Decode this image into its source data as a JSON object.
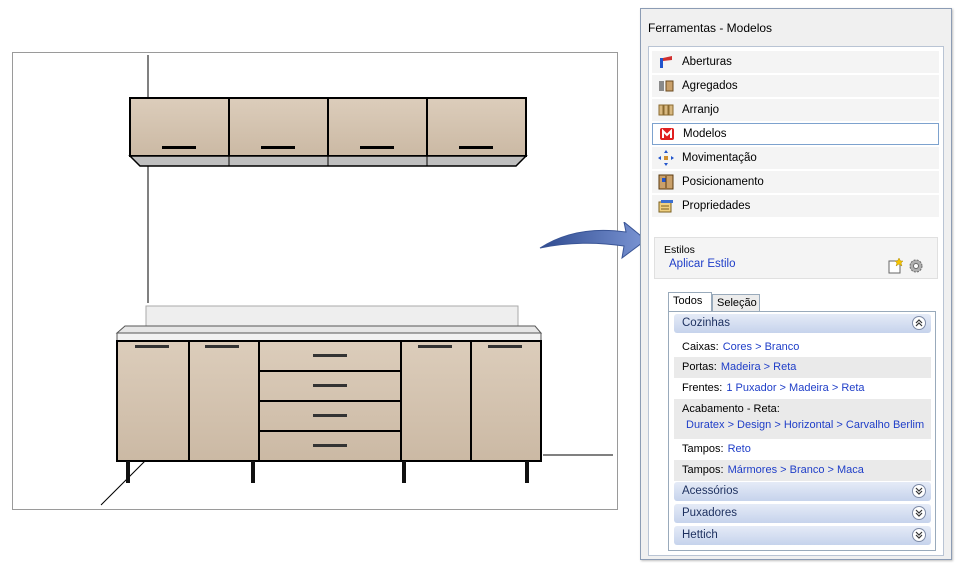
{
  "panel": {
    "title": "Ferramentas - Modelos",
    "menu": [
      {
        "label": "Aberturas",
        "icon": "aberturas-icon"
      },
      {
        "label": "Agregados",
        "icon": "agregados-icon"
      },
      {
        "label": "Arranjo",
        "icon": "arranjo-icon"
      },
      {
        "label": "Modelos",
        "icon": "modelos-icon"
      },
      {
        "label": "Movimentação",
        "icon": "movimentacao-icon"
      },
      {
        "label": "Posicionamento",
        "icon": "posicionamento-icon"
      },
      {
        "label": "Propriedades",
        "icon": "propriedades-icon"
      }
    ],
    "estilos": {
      "label": "Estilos",
      "link": "Aplicar Estilo"
    },
    "tabs": [
      "Todos",
      "Seleção"
    ],
    "groups": {
      "cozinhas": "Cozinhas",
      "acessorios": "Acessórios",
      "puxadores": "Puxadores",
      "hettich": "Hettich"
    },
    "properties": {
      "caixas_label": "Caixas:",
      "caixas_value": "Cores > Branco",
      "portas_label": "Portas:",
      "portas_value": "Madeira > Reta",
      "frentes_label": "Frentes:",
      "frentes_value": "1 Puxador > Madeira > Reta",
      "acabamento_label": "Acabamento - Reta:",
      "acabamento_value": "Duratex > Design > Horizontal > Carvalho Berlim",
      "tampos1_label": "Tampos:",
      "tampos1_value": "Reto",
      "tampos2_label": "Tampos:",
      "tampos2_value": "Mármores > Branco > Maca"
    }
  },
  "colors": {
    "wood": "#d6c6b3",
    "link": "#1f3ec8",
    "arrow": "#5b74b3",
    "group_header": "#c6d3ec"
  }
}
